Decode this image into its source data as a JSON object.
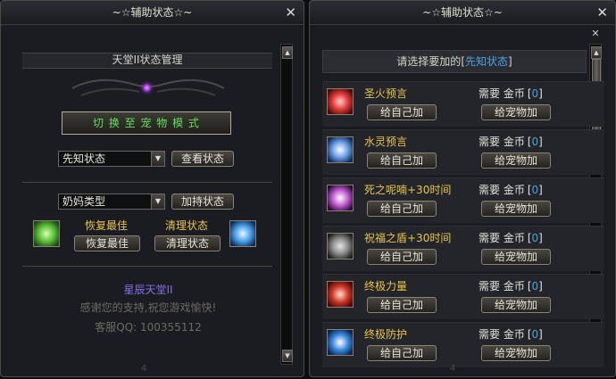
{
  "left": {
    "title": "~☆辅助状态☆~",
    "close": "✕",
    "section_header": "天堂II状态管理",
    "pet_button": "切 换 至 宠 物 模 式",
    "select1_value": "先知状态",
    "view_button": "查看状态",
    "select2_value": "奶妈类型",
    "add_button": "加持状态",
    "restore_label": "恢复最佳",
    "restore_button": "恢复最佳",
    "clear_label": "清理状态",
    "clear_button": "清理状态",
    "footer_title": "星辰天堂II",
    "footer_thanks": "感谢您的支持,祝您游戏愉快!",
    "footer_contact": "客服QQ: 100355112",
    "bottom_mark": "4"
  },
  "right": {
    "title": "~☆辅助状态☆~",
    "close": "✕",
    "header_prefix": "请选择要加的",
    "header_lb": "[",
    "header_highlight": "先知状态",
    "header_rb": "]",
    "rows": [
      {
        "name": "圣火预言",
        "icon": "flame-red-icon",
        "price_label": "需要 金币",
        "lb": "[",
        "price": "0",
        "rb": "]",
        "self": "给自己加",
        "pet": "给宠物加"
      },
      {
        "name": "水灵预言",
        "icon": "water-spirit-icon",
        "price_label": "需要 金币",
        "lb": "[",
        "price": "0",
        "rb": "]",
        "self": "给自己加",
        "pet": "给宠物加"
      },
      {
        "name": "死之呢喃+30时间",
        "icon": "death-skull-icon",
        "price_label": "需要 金币",
        "lb": "[",
        "price": "0",
        "rb": "]",
        "self": "给自己加",
        "pet": "给宠物加"
      },
      {
        "name": "祝福之盾+30时间",
        "icon": "blessed-shield-icon",
        "price_label": "需要 金币",
        "lb": "[",
        "price": "0",
        "rb": "]",
        "self": "给自己加",
        "pet": "给宠物加"
      },
      {
        "name": "终极力量",
        "icon": "ultimate-power-icon",
        "price_label": "需要 金币",
        "lb": "[",
        "price": "0",
        "rb": "]",
        "self": "给自己加",
        "pet": "给宠物加"
      },
      {
        "name": "终极防护",
        "icon": "ultimate-defense-icon",
        "price_label": "需要 金币",
        "lb": "[",
        "price": "0",
        "rb": "]",
        "self": "给自己加",
        "pet": "给宠物加"
      }
    ],
    "bottom_mark": "4"
  },
  "colors": {
    "gold": "#e8c64a",
    "blue": "#4aa3e0",
    "green": "#62e05a",
    "purple": "#8a6ee8"
  },
  "scroll": {
    "left_position": 0.0,
    "right_position": 0.0
  }
}
